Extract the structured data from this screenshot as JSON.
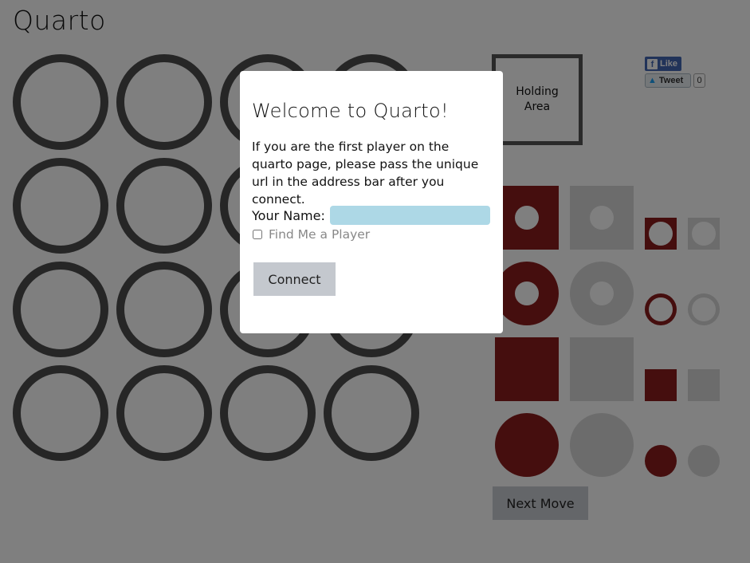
{
  "page": {
    "title": "Quarto"
  },
  "holding_area": {
    "label_line1": "Holding",
    "label_line2": "Area"
  },
  "social": {
    "like_label": "Like",
    "tweet_label": "Tweet",
    "tweet_count": "0"
  },
  "controls": {
    "next_move_label": "Next Move"
  },
  "modal": {
    "title": "Welcome to Quarto!",
    "description": "If you are the first player on the quarto page, please pass the unique url in the address bar after you connect.",
    "name_label": "Your Name:",
    "name_value": "",
    "find_player_label": "Find Me a Player",
    "find_player_checked": false,
    "connect_label": "Connect"
  },
  "colors": {
    "piece_dark": "#8b1d1d",
    "piece_light": "#d8d8d8",
    "board_ring": "#4d4d4d",
    "input_bg": "#add8e6"
  }
}
